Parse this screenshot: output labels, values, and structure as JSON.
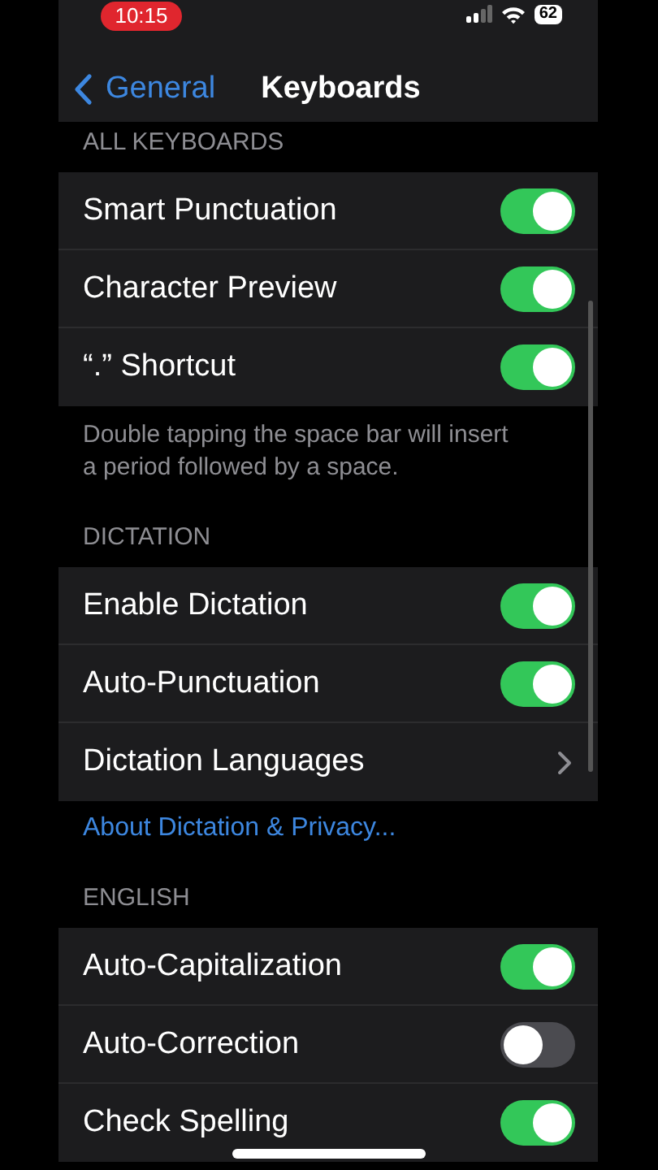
{
  "status_bar": {
    "time": "10:15",
    "battery": "62"
  },
  "nav": {
    "back": "General",
    "title": "Keyboards"
  },
  "sections": [
    {
      "header": "ALL KEYBOARDS",
      "rows": [
        {
          "label": "Smart Punctuation",
          "kind": "toggle",
          "on": true
        },
        {
          "label": "Character Preview",
          "kind": "toggle",
          "on": true
        },
        {
          "label": "“.” Shortcut",
          "kind": "toggle",
          "on": true
        }
      ],
      "footer": "Double tapping the space bar will insert a period followed by a space."
    },
    {
      "header": "DICTATION",
      "rows": [
        {
          "label": "Enable Dictation",
          "kind": "toggle",
          "on": true
        },
        {
          "label": "Auto-Punctuation",
          "kind": "toggle",
          "on": true
        },
        {
          "label": "Dictation Languages",
          "kind": "link"
        }
      ],
      "link": "About Dictation & Privacy..."
    },
    {
      "header": "ENGLISH",
      "rows": [
        {
          "label": "Auto-Capitalization",
          "kind": "toggle",
          "on": true
        },
        {
          "label": "Auto-Correction",
          "kind": "toggle",
          "on": false
        },
        {
          "label": "Check Spelling",
          "kind": "toggle",
          "on": true
        }
      ]
    }
  ]
}
